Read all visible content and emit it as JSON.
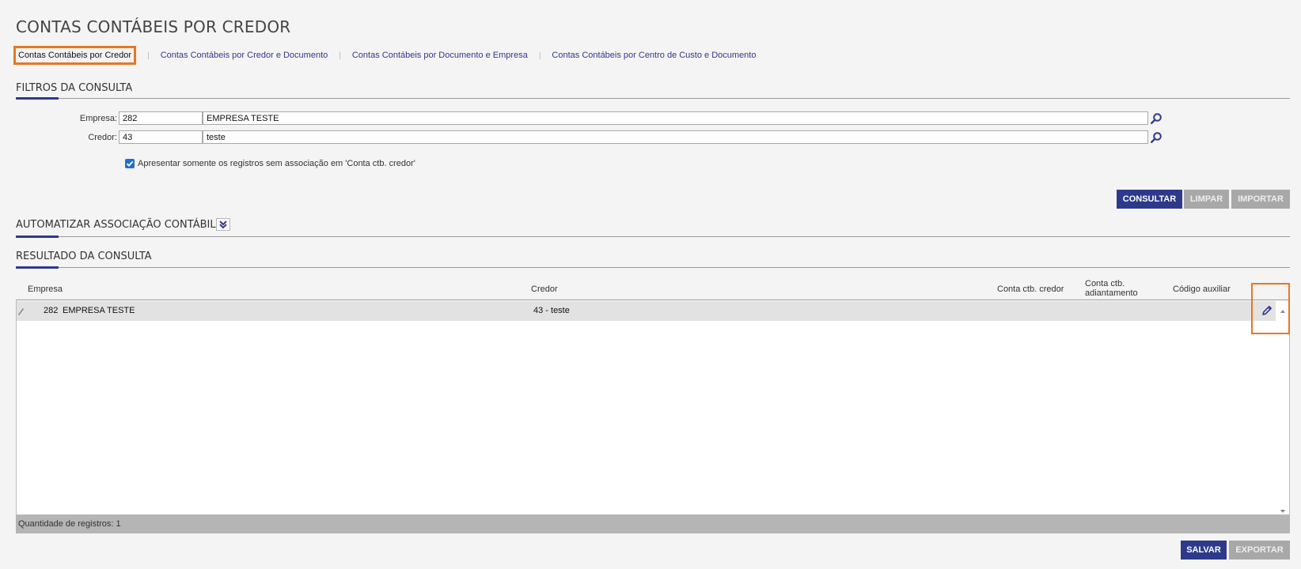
{
  "page": {
    "title": "CONTAS CONTÁBEIS POR CREDOR"
  },
  "tabs": [
    {
      "label": "Contas Contábeis por Credor"
    },
    {
      "label": "Contas Contábeis por Credor e Documento"
    },
    {
      "label": "Contas Contábeis por Documento e Empresa"
    },
    {
      "label": "Contas Contábeis por Centro de Custo e Documento"
    }
  ],
  "tab_separator": "|",
  "filters": {
    "title": "FILTROS DA CONSULTA",
    "empresa": {
      "label": "Empresa:",
      "code": "282",
      "name": "EMPRESA TESTE"
    },
    "credor": {
      "label": "Credor:",
      "code": "43",
      "name": "teste"
    },
    "checkbox_label": "Apresentar somente os registros sem associação em 'Conta ctb. credor'",
    "checkbox_checked": true
  },
  "buttons": {
    "consultar": "CONSULTAR",
    "limpar": "LIMPAR",
    "importar": "IMPORTAR",
    "salvar": "SALVAR",
    "exportar": "EXPORTAR"
  },
  "automatizar": {
    "title": "AUTOMATIZAR ASSOCIAÇÃO CONTÁBIL"
  },
  "resultado": {
    "title": "RESULTADO DA CONSULTA",
    "columns": {
      "empresa": "Empresa",
      "credor": "Credor",
      "conta_credor": "Conta ctb. credor",
      "conta_adiant_1": "Conta ctb.",
      "conta_adiant_2": "adiantamento",
      "codigo_aux": "Código auxiliar"
    },
    "rows": [
      {
        "empresa_code": "282",
        "empresa_name": "EMPRESA TESTE",
        "credor": "43 - teste",
        "conta_credor": "",
        "conta_adiantamento": "",
        "codigo_auxiliar": ""
      }
    ],
    "footer": "Quantidade de registros: 1"
  },
  "icons": {
    "search": "search-icon",
    "edit": "pencil-icon",
    "expand": "double-chevron-down-icon"
  },
  "colors": {
    "primary": "#2d3a8c",
    "highlight": "#e87722",
    "disabled": "#a8a8a8"
  }
}
